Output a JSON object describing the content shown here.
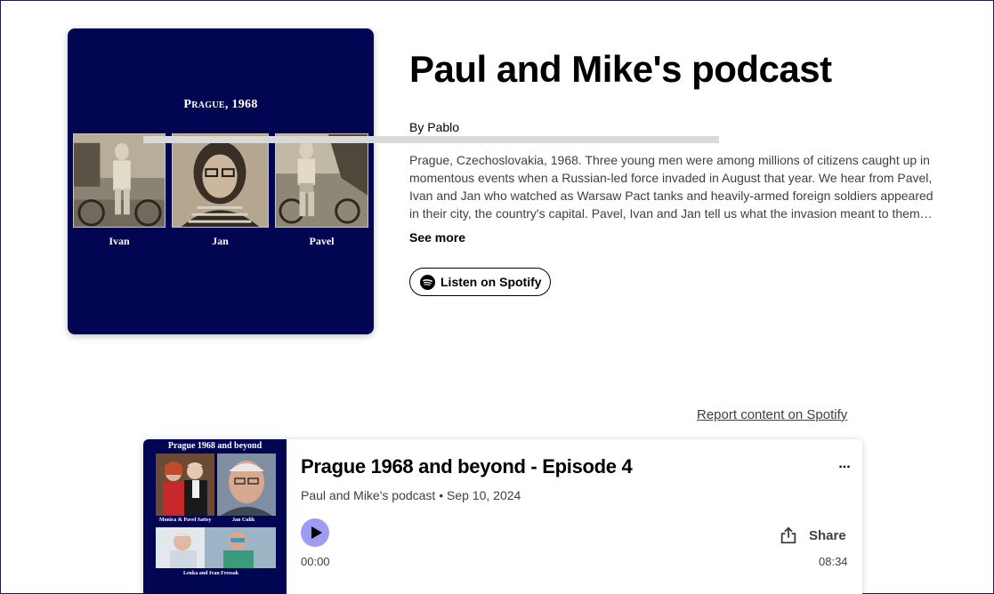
{
  "show": {
    "title": "Paul and Mike's podcast",
    "author": "By Pablo",
    "description": "Prague, Czechoslovakia, 1968. Three young men were among millions of citizens caught up in momentous events when a Russian-led force invaded in August that year. We hear from Pavel, Ivan and Jan who watched as Warsaw Pact tanks and heavily-armed foreign soldiers appeared in their city, the country's capital. Pavel, Ivan and Jan tell us what the invasion meant to them…",
    "see_more": "See more",
    "listen_label": "Listen on Spotify",
    "cover": {
      "title": "Prague, 1968",
      "labels": [
        "Ivan",
        "Jan",
        "Pavel"
      ]
    }
  },
  "report_link": "Report content on Spotify",
  "episode": {
    "title": "Prague 1968 and beyond - Episode 4",
    "show_name": "Paul and Mike's podcast",
    "separator": " • ",
    "date": "Sep 10, 2024",
    "more_label": "...",
    "share_label": "Share",
    "time_current": "00:00",
    "time_total": "08:34",
    "progress": 0,
    "art": {
      "title": "Prague 1968 and beyond",
      "captions": [
        "Monica & Pavel Sattsy",
        "Jan Culik",
        "Lenka and Ivan Fressak"
      ]
    }
  },
  "colors": {
    "cover_bg": "#020552",
    "play_button": "#9c9cf2",
    "secondary_text": "#3f3f3f"
  },
  "icons": {
    "listen": "spotify-icon",
    "play": "play-icon",
    "share": "share-icon",
    "more": "more-options-icon"
  }
}
